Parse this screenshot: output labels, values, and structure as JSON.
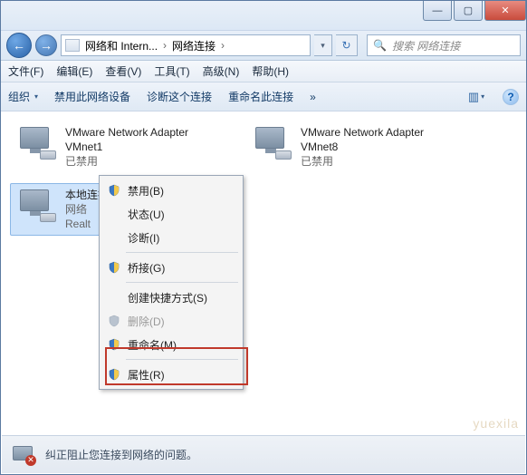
{
  "window": {
    "min_glyph": "—",
    "max_glyph": "▢",
    "close_glyph": "✕"
  },
  "nav": {
    "back_glyph": "←",
    "fwd_glyph": "→",
    "crumb1": "网络和 Intern...",
    "crumb2": "网络连接",
    "sep": "›",
    "drop_glyph": "▾",
    "refresh_glyph": "↻"
  },
  "search": {
    "placeholder": "搜索 网络连接",
    "icon": "🔍"
  },
  "menu": {
    "file": "文件(F)",
    "edit": "编辑(E)",
    "view": "查看(V)",
    "tools": "工具(T)",
    "advanced": "高级(N)",
    "help": "帮助(H)"
  },
  "toolbar": {
    "organize": "组织",
    "disable": "禁用此网络设备",
    "diagnose": "诊断这个连接",
    "rename": "重命名此连接",
    "more_glyph": "»",
    "view_glyph": "▥",
    "view_drop": "▾",
    "help_glyph": "?"
  },
  "connections": [
    {
      "name": "VMware Network Adapter VMnet1",
      "status": "已禁用"
    },
    {
      "name": "VMware Network Adapter VMnet8",
      "status": "已禁用"
    },
    {
      "name": "本地连接",
      "sub1": "网络",
      "sub2": "Realt"
    }
  ],
  "context_menu": {
    "disable": "禁用(B)",
    "status": "状态(U)",
    "diagnose": "诊断(I)",
    "bridge": "桥接(G)",
    "shortcut": "创建快捷方式(S)",
    "delete": "删除(D)",
    "rename": "重命名(M)",
    "properties": "属性(R)"
  },
  "statusbar": {
    "text": "纠正阻止您连接到网络的问题。",
    "x_glyph": "✕"
  },
  "watermark": "yuexila"
}
